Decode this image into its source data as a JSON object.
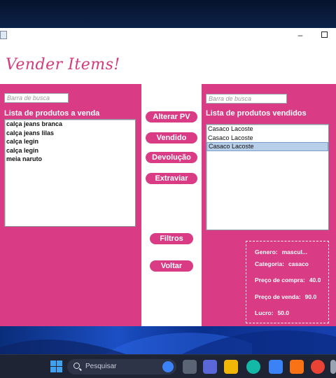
{
  "window": {
    "minimize_glyph": "–",
    "app_title": "Vender Items!"
  },
  "left_panel": {
    "search_placeholder": "Barra de busca",
    "label": "Lista de produtos a venda",
    "items": [
      "calça jeans branca",
      "calça jeans lilas",
      "calça legin",
      "calça legin",
      "meia naruto"
    ]
  },
  "right_panel": {
    "search_placeholder": "Barra de busca",
    "label": "Lista de produtos vendidos",
    "items": [
      "Casaco Lacoste",
      "Casaco Lacoste",
      "Casaco Lacoste"
    ],
    "selected_index": 2
  },
  "buttons": {
    "alterar": "Alterar PV",
    "vendido": "Vendido",
    "devolucao": "Devolução",
    "extraviar": "Extraviar",
    "filtros": "Filtros",
    "voltar": "Voltar"
  },
  "details": {
    "genero_label": "Genero:",
    "genero_value": "mascul...",
    "categoria_label": "Categoria:",
    "categoria_value": "casaco",
    "compra_label": "Preço de compra:",
    "compra_value": "40.0",
    "venda_label": "Preço de venda:",
    "venda_value": "90.0",
    "lucro_label": "Lucro:",
    "lucro_value": "50.0"
  },
  "taskbar": {
    "search_label": "Pesquisar"
  },
  "colors": {
    "panel": "#d93c84",
    "title": "#d63a7e",
    "selection": "#b8cfe9"
  }
}
